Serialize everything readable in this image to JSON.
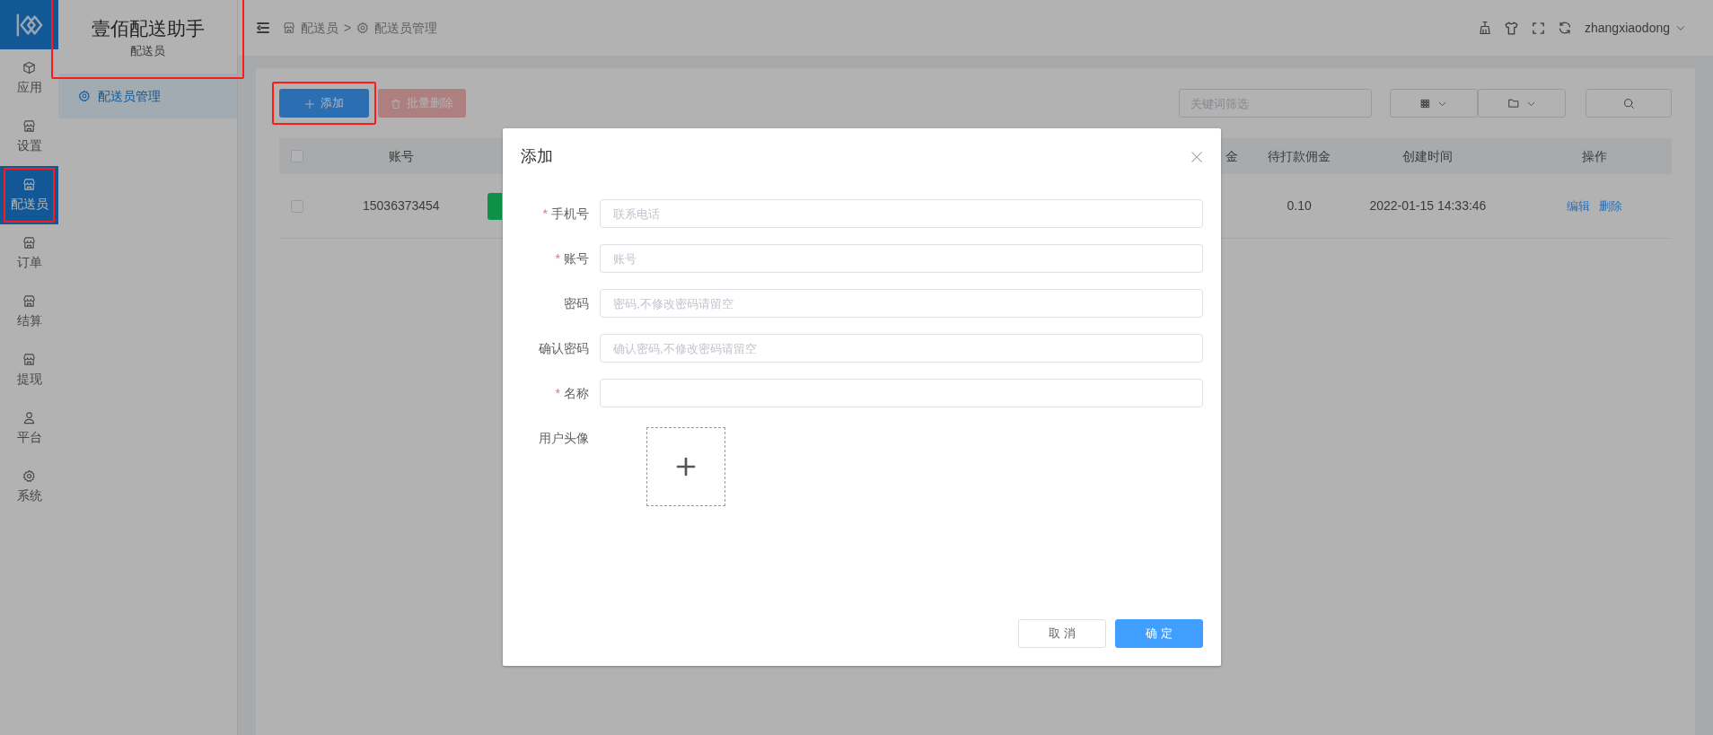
{
  "rail": {
    "items": [
      {
        "label": "应用",
        "selected": false,
        "highlighted": false
      },
      {
        "label": "设置",
        "selected": false,
        "highlighted": false
      },
      {
        "label": "配送员",
        "selected": true,
        "highlighted": true
      },
      {
        "label": "订单",
        "selected": false,
        "highlighted": false
      },
      {
        "label": "结算",
        "selected": false,
        "highlighted": false
      },
      {
        "label": "提现",
        "selected": false,
        "highlighted": false
      },
      {
        "label": "平台",
        "selected": false,
        "highlighted": false
      },
      {
        "label": "系统",
        "selected": false,
        "highlighted": false
      }
    ]
  },
  "header": {
    "title": "壹佰配送助手",
    "subtitle": "配送员",
    "highlighted": true,
    "breadcrumb": [
      "配送员",
      "配送员管理"
    ],
    "separator": ">",
    "user": "zhangxiaodong"
  },
  "submenu": {
    "items": [
      {
        "label": "配送员管理",
        "selected": true
      }
    ]
  },
  "toolbar": {
    "add_button": {
      "label": "添加",
      "highlighted": true
    },
    "delete_button": {
      "label": "批量删除",
      "disabled": true
    },
    "search": {
      "placeholder": "关键词筛选"
    }
  },
  "table": {
    "header_checked": false,
    "columns": [
      "账号",
      "金",
      "待打款佣金",
      "创建时间",
      "操作"
    ],
    "rows": [
      {
        "checked": false,
        "account": "15036373454",
        "pending_commission": "0.10",
        "created": "2022-01-15 14:33:46",
        "actions": [
          "编辑",
          "删除"
        ]
      }
    ]
  },
  "modal": {
    "title": "添加",
    "required_mark": "*",
    "fields": [
      {
        "label": "手机号",
        "required": true,
        "placeholder": "联系电话"
      },
      {
        "label": "账号",
        "required": true,
        "placeholder": "账号"
      },
      {
        "label": "密码",
        "required": false,
        "placeholder": "密码,不修改密码请留空"
      },
      {
        "label": "确认密码",
        "required": false,
        "placeholder": "确认密码,不修改密码请留空"
      },
      {
        "label": "名称",
        "required": true
      }
    ],
    "upload": {
      "label": "用户头像"
    },
    "buttons": [
      {
        "label": "取 消",
        "kind": "default"
      },
      {
        "label": "确 定",
        "kind": "primary"
      }
    ]
  }
}
